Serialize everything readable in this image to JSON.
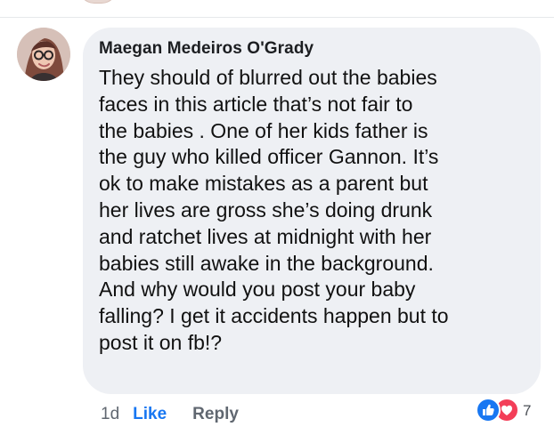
{
  "comment": {
    "author": "Maegan Medeiros O'Grady",
    "text_lines": [
      "They should of blurred out the babies",
      "faces in this article that’s not fair to",
      "the babies . One of her kids father is",
      "the guy who killed officer Gannon. It’s",
      "ok to make mistakes as a parent but",
      "her lives are gross she’s doing drunk",
      "and ratchet lives at midnight with her",
      "babies still awake in the background.",
      "And why would you post your baby",
      "falling? I get it accidents happen but to",
      "post it on fb!?"
    ]
  },
  "actions": {
    "timestamp": "1d",
    "like_label": "Like",
    "reply_label": "Reply"
  },
  "reactions": {
    "icons": [
      "like-icon",
      "love-icon"
    ],
    "count": "7",
    "colors": {
      "like": "#1877f2",
      "love": "#f33e58"
    }
  },
  "icons": {
    "avatar": "avatar",
    "previous_avatar": "avatar"
  }
}
